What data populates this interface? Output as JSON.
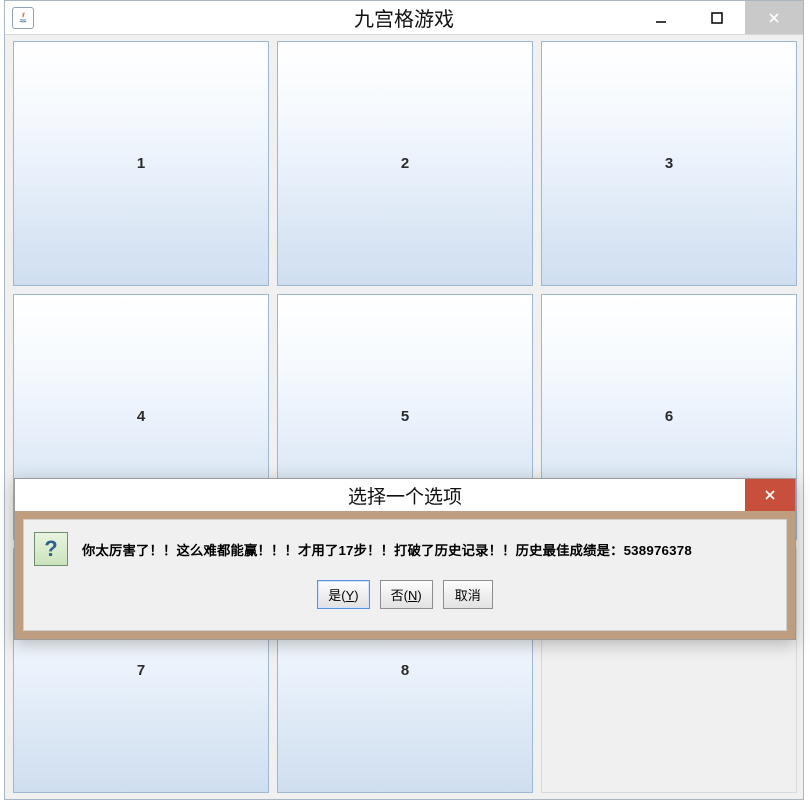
{
  "window": {
    "title": "九宫格游戏"
  },
  "tiles": [
    "1",
    "2",
    "3",
    "4",
    "5",
    "6",
    "7",
    "8",
    ""
  ],
  "dialog": {
    "title": "选择一个选项",
    "message": "你太厉害了！！这么难都能赢！！！才用了17步！！打破了历史记录！！历史最佳成绩是：538976378",
    "steps_used": 17,
    "previous_best": 538976378,
    "icon_glyph": "?",
    "buttons": {
      "yes_label": "是",
      "yes_mnemonic": "Y",
      "no_label": "否",
      "no_mnemonic": "N",
      "cancel_label": "取消"
    }
  },
  "colors": {
    "tile_gradient_top": "#ffffff",
    "tile_gradient_bottom": "#cfdeef",
    "tile_border": "#9eb7d0",
    "dialog_frame": "#bf9e80",
    "dialog_close": "#c94f3d",
    "win_close": "#c9c9c9"
  }
}
